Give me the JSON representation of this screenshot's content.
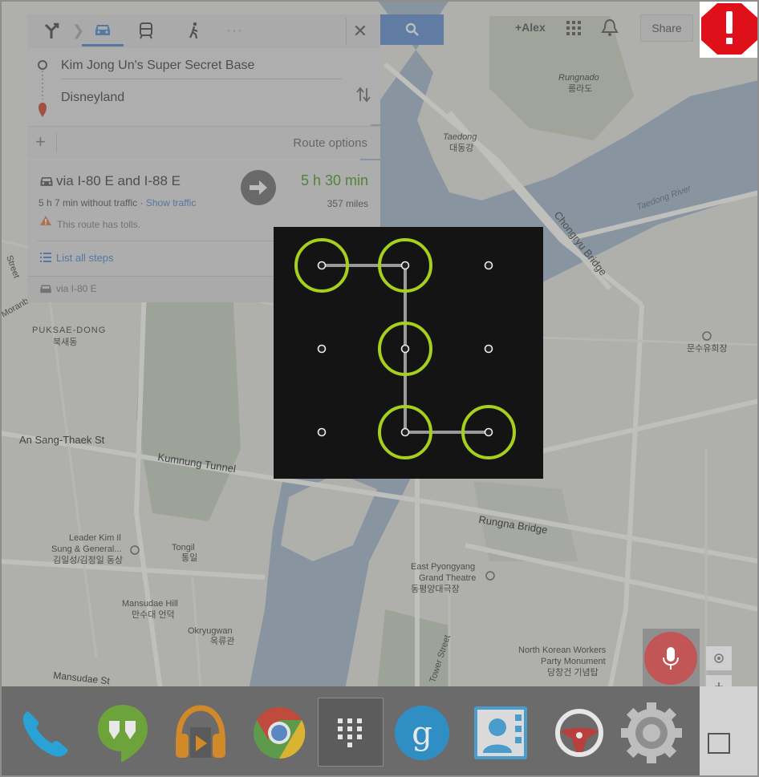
{
  "header": {
    "user": "+Alex",
    "share_label": "Share"
  },
  "directions": {
    "origin": "Kim Jong Un's Super Secret Base",
    "destination": "Disneyland",
    "route_options_label": "Route options",
    "route": {
      "title": "via I-80 E and I-88 E",
      "duration": "5 h 30 min",
      "without_traffic": "5 h 7 min without traffic · ",
      "show_traffic_label": "Show traffic",
      "distance": "357 miles",
      "warning": "This route has tolls.",
      "list_steps_label": "List all steps",
      "alternate": "via I-80 E"
    }
  },
  "map_labels": {
    "rungnado": "Rungnado",
    "rungnado_kr": "릉라도",
    "taedong": "Taedong",
    "taedong_kr": "대동강",
    "taedong_river": "Taedong River",
    "chongryu": "Chongryu Bridge",
    "puksae": "PUKSAE-DONG",
    "puksae_kr": "북새동",
    "ansang": "An Sang-Thaek St",
    "kumnung": "Kumnung Tunnel",
    "rungna_bridge": "Rungna Bridge",
    "leader": "Leader Kim Il",
    "leader2": "Sung & General...",
    "leader_kr": "김일성/김정일 동상",
    "tongil": "Tongil",
    "tongil_kr": "통일",
    "mansudae_hill": "Mansudae Hill",
    "mansudae_hill_kr": "만수대 언덕",
    "okryugwan": "Okryugwan",
    "okryugwan_kr": "옥류관",
    "mansudae_st": "Mansudae St",
    "east_pyongyang": "East Pyongyang",
    "grand_theatre": "Grand Theatre",
    "grand_theatre_kr": "동평양대극장",
    "nk_workers": "North Korean Workers",
    "party_monument": "Party Monument",
    "party_monument_kr": "당창건 기념탑",
    "tower_st": "Tower Street",
    "stadium_kr": "문수유희장",
    "moranbong": "Moranbong",
    "street": "Street"
  },
  "pattern_lock": {
    "grid_size": 3,
    "path": [
      0,
      1,
      4,
      7,
      8
    ],
    "ring_color": "#a6d01c"
  },
  "dock": {
    "apps": [
      "phone-icon",
      "hangouts-icon",
      "play-music-icon",
      "chrome-icon",
      "app-drawer-icon",
      "google-search-icon",
      "contacts-icon",
      "car-mode-icon",
      "settings-icon"
    ]
  },
  "colors": {
    "alert_red": "#e0101a",
    "accent_blue": "#5d8fc8",
    "duration_green": "#5b9b3a"
  }
}
